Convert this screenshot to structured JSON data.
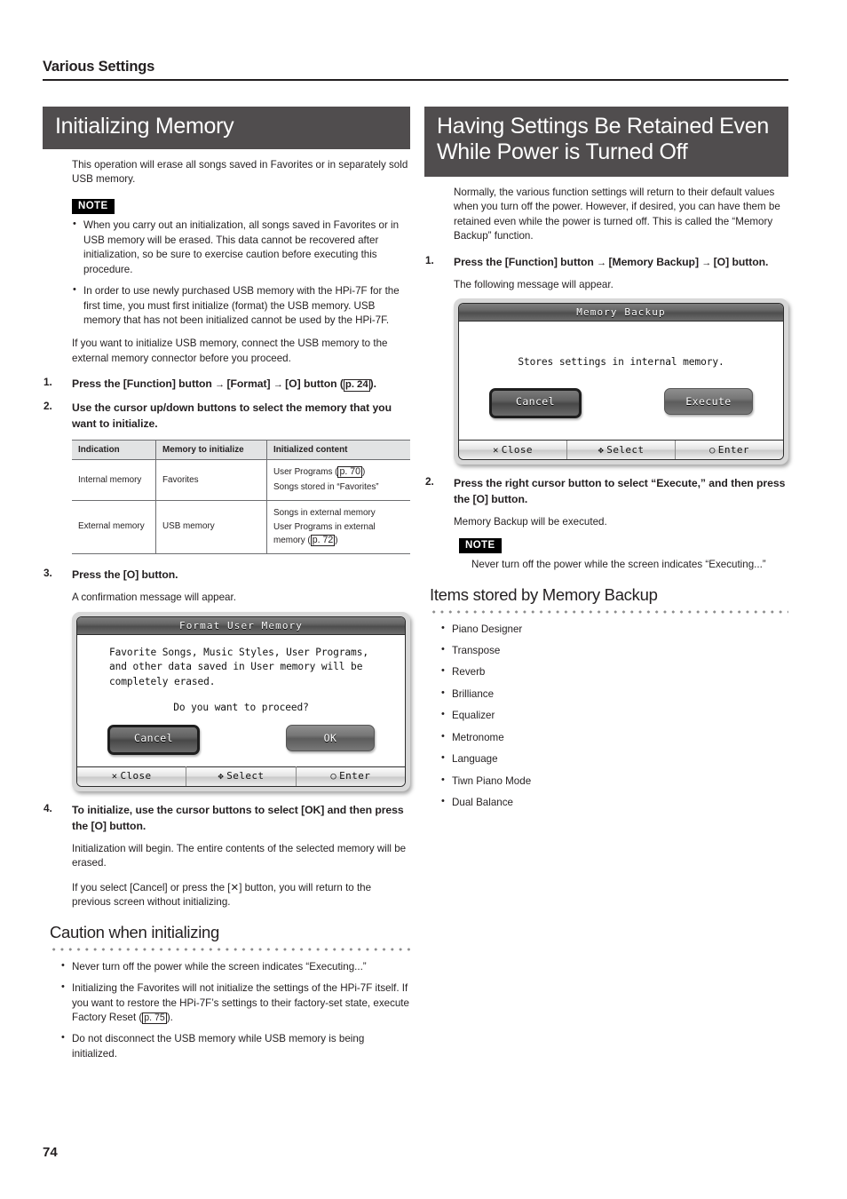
{
  "running_head": {
    "title": "Various Settings"
  },
  "page_number": "74",
  "left_column": {
    "banner": "Initializing Memory",
    "intro": "This operation will erase all songs saved in Favorites or in separately sold USB memory.",
    "note_label": "NOTE",
    "note_items": [
      "When you carry out an initialization, all songs saved in Favorites or in USB memory will be erased. This data cannot be recovered after initialization, so be sure to exercise caution before executing this procedure.",
      "In order to use newly purchased USB memory with the HPi-7F for the first time, you must first initialize (format) the USB memory. USB memory that has not been initialized cannot be used by the HPi-7F."
    ],
    "after_note": "If you want to initialize USB memory, connect the USB memory to the external memory connector before you proceed.",
    "step1": {
      "number": "1.",
      "text_a": "Press the [Function] button",
      "arrow": "→",
      "text_b": "[Format]",
      "text_c": "[O] button (",
      "pageref": "p. 24",
      "text_d": ")."
    },
    "step2": {
      "number": "2.",
      "text": "Use the cursor up/down buttons to select the memory that you want to initialize."
    },
    "table": {
      "headers": [
        "Indication",
        "Memory to initialize",
        "Initialized content"
      ],
      "rows": [
        {
          "indication": "Internal memory",
          "memory": "Favorites",
          "content_lines": [
            "User Programs (",
            "Songs stored in “Favorites”"
          ],
          "content_ref": "p. 70",
          "content_ref_tail": ")"
        },
        {
          "indication": "External memory",
          "memory": "USB memory",
          "content_lines": [
            "Songs in external memory",
            "User Programs in external memory ("
          ],
          "content_ref": "p. 72",
          "content_ref_tail": ")"
        }
      ]
    },
    "step3": {
      "number": "3.",
      "text": "Press the [O] button.",
      "sub": "A confirmation message will appear."
    },
    "lcd": {
      "title": "Format User Memory",
      "message_lines": [
        "Favorite Songs, Music Styles, User Programs,",
        "and other data saved in User memory will be",
        "completely erased."
      ],
      "question": "Do you want to proceed?",
      "button_left": "Cancel",
      "button_right": "OK",
      "footer": [
        {
          "glyph": "✕",
          "label": "Close"
        },
        {
          "glyph": "✥",
          "label": "Select"
        },
        {
          "glyph": "○",
          "label": "Enter"
        }
      ]
    },
    "step4": {
      "number": "4.",
      "text": "To initialize, use the cursor buttons to select [OK] and then press the [O] button.",
      "sub1": "Initialization will begin. The entire contents of the selected memory will be erased.",
      "sub2": "If you select [Cancel] or press the [✕] button, you will return to the previous screen without initializing."
    },
    "caution": {
      "heading": "Caution when initializing",
      "items": [
        {
          "text": "Never turn off the power while the screen indicates “Executing...”"
        },
        {
          "text_a": "Initializing the Favorites will not initialize the settings of the HPi-7F itself. If you want to restore the HPi-7F’s settings to their factory-set state, execute Factory Reset (",
          "pageref": "p. 75",
          "text_b": ")."
        },
        {
          "text": "Do not disconnect the USB memory while USB memory is being initialized."
        }
      ]
    }
  },
  "right_column": {
    "banner": "Having Settings Be Retained Even While Power is Turned Off",
    "intro": "Normally, the various function settings will return to their default values when you turn off the power. However, if desired, you can have them be retained even while the power is turned off. This is called the “Memory Backup” function.",
    "step1": {
      "number": "1.",
      "text_a": "Press the [Function] button",
      "arrow": "→",
      "text_b": "[Memory Backup]",
      "text_c": "[O] button.",
      "sub": "The following message will appear."
    },
    "lcd": {
      "title": "Memory Backup",
      "message": "Stores settings in internal memory.",
      "button_left": "Cancel",
      "button_right": "Execute",
      "footer": [
        {
          "glyph": "✕",
          "label": "Close"
        },
        {
          "glyph": "✥",
          "label": "Select"
        },
        {
          "glyph": "○",
          "label": "Enter"
        }
      ]
    },
    "step2": {
      "number": "2.",
      "text": "Press the right cursor button to select “Execute,” and then press the [O] button.",
      "sub": "Memory Backup will be executed."
    },
    "note_label": "NOTE",
    "note_text": "Never turn off the power while the screen indicates “Executing...”",
    "items_section": {
      "heading": "Items stored by Memory Backup",
      "items": [
        "Piano Designer",
        "Transpose",
        "Reverb",
        "Brilliance",
        "Equalizer",
        "Metronome",
        "Language",
        "Tiwn Piano Mode",
        "Dual Balance"
      ]
    }
  },
  "colors": {
    "banner_bg": "#504d4e",
    "note_badge_bg": "#000000",
    "table_header_bg": "#e2e3e4",
    "text": "#231f20"
  }
}
